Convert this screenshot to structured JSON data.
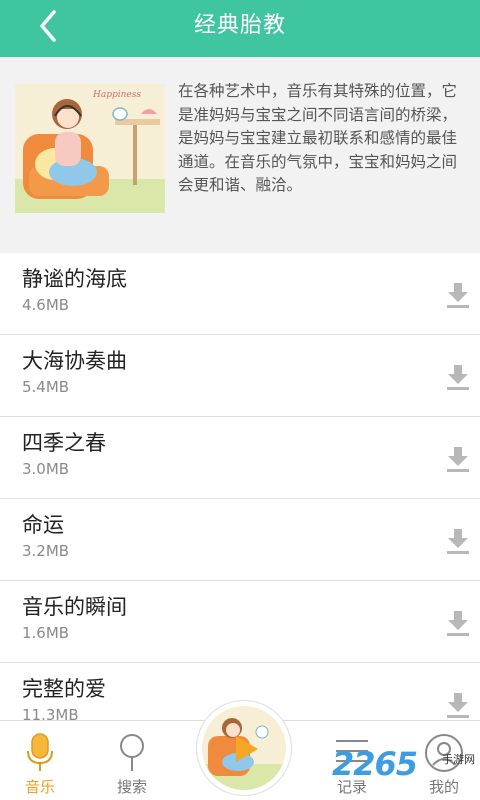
{
  "header": {
    "title": "经典胎教"
  },
  "intro": {
    "text": "在各种艺术中，音乐有其特殊的位置，它是准妈妈与宝宝之间不同语言间的桥梁，是妈妈与宝宝建立最初联系和感情的最佳通道。在音乐的气氛中，宝宝和妈妈之间会更和谐、融洽。",
    "image_caption": "Happiness"
  },
  "songs": [
    {
      "title": "静谧的海底",
      "size": "4.6MB"
    },
    {
      "title": "大海协奏曲",
      "size": "5.4MB"
    },
    {
      "title": "四季之春",
      "size": "3.0MB"
    },
    {
      "title": "命运",
      "size": "3.2MB"
    },
    {
      "title": "音乐的瞬间",
      "size": "1.6MB"
    },
    {
      "title": "完整的爱",
      "size": "11.3MB"
    }
  ],
  "tabs": [
    {
      "label": "音乐",
      "icon": "microphone-icon",
      "active": true
    },
    {
      "label": "搜索",
      "icon": "search-icon",
      "active": false
    },
    {
      "label": "记录",
      "icon": "list-icon",
      "active": false
    },
    {
      "label": "我的",
      "icon": "user-icon",
      "active": false
    }
  ],
  "watermark": {
    "number": "2265",
    "sub1": "手游网",
    "sub2": ""
  },
  "colors": {
    "header": "#3fc6a0",
    "active_tab": "#f0a020",
    "accent_play": "#f5a623"
  }
}
